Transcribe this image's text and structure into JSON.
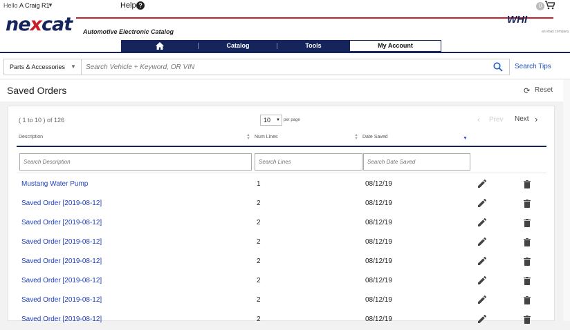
{
  "topbar": {
    "greeting": "Hello",
    "user": "A Craig R1",
    "help": "Help",
    "help_icon": "?",
    "cart_count": "0",
    "icons": {
      "user_caret": "caret-down-icon",
      "help": "question-icon",
      "cart": "cart-icon"
    }
  },
  "header": {
    "logo_prefix": "ne",
    "logo_x": "x",
    "logo_suffix": "cat",
    "tagline": "Automotive Electronic Catalog",
    "partner_logo": "WHI",
    "partner_sub": "an ebay company",
    "colors": {
      "brand_navy": "#15255c",
      "brand_red": "#c8202a",
      "link_blue": "#1e3fc0"
    }
  },
  "nav": {
    "tabs": [
      {
        "label": "",
        "icon": "home-icon"
      },
      {
        "label": "Catalog"
      },
      {
        "label": "Tools"
      },
      {
        "label": "My Account",
        "active": true
      }
    ]
  },
  "search": {
    "category": "Parts & Accessories",
    "placeholder": "Search Vehicle + Keyword, OR VIN",
    "tips": "Search Tips"
  },
  "page": {
    "title": "Saved Orders",
    "reset": "Reset"
  },
  "list": {
    "range": "( 1 to 10 ) of 126",
    "per_page_value": "10",
    "per_page_label": "per page",
    "prev": "Prev",
    "next": "Next",
    "columns": [
      "Description",
      "Num Lines",
      "Date Saved"
    ],
    "filters": {
      "description_placeholder": "Search Description",
      "lines_placeholder": "Search Lines",
      "date_placeholder": "Search Date Saved"
    },
    "rows": [
      {
        "description": "Mustang Water Pump",
        "lines": "1",
        "date": "08/12/19"
      },
      {
        "description": "Saved Order [2019-08-12]",
        "lines": "2",
        "date": "08/12/19"
      },
      {
        "description": "Saved Order [2019-08-12]",
        "lines": "2",
        "date": "08/12/19"
      },
      {
        "description": "Saved Order [2019-08-12]",
        "lines": "2",
        "date": "08/12/19"
      },
      {
        "description": "Saved Order [2019-08-12]",
        "lines": "2",
        "date": "08/12/19"
      },
      {
        "description": "Saved Order [2019-08-12]",
        "lines": "2",
        "date": "08/12/19"
      },
      {
        "description": "Saved Order [2019-08-12]",
        "lines": "2",
        "date": "08/12/19"
      },
      {
        "description": "Saved Order [2019-08-12]",
        "lines": "2",
        "date": "08/12/19"
      }
    ]
  }
}
